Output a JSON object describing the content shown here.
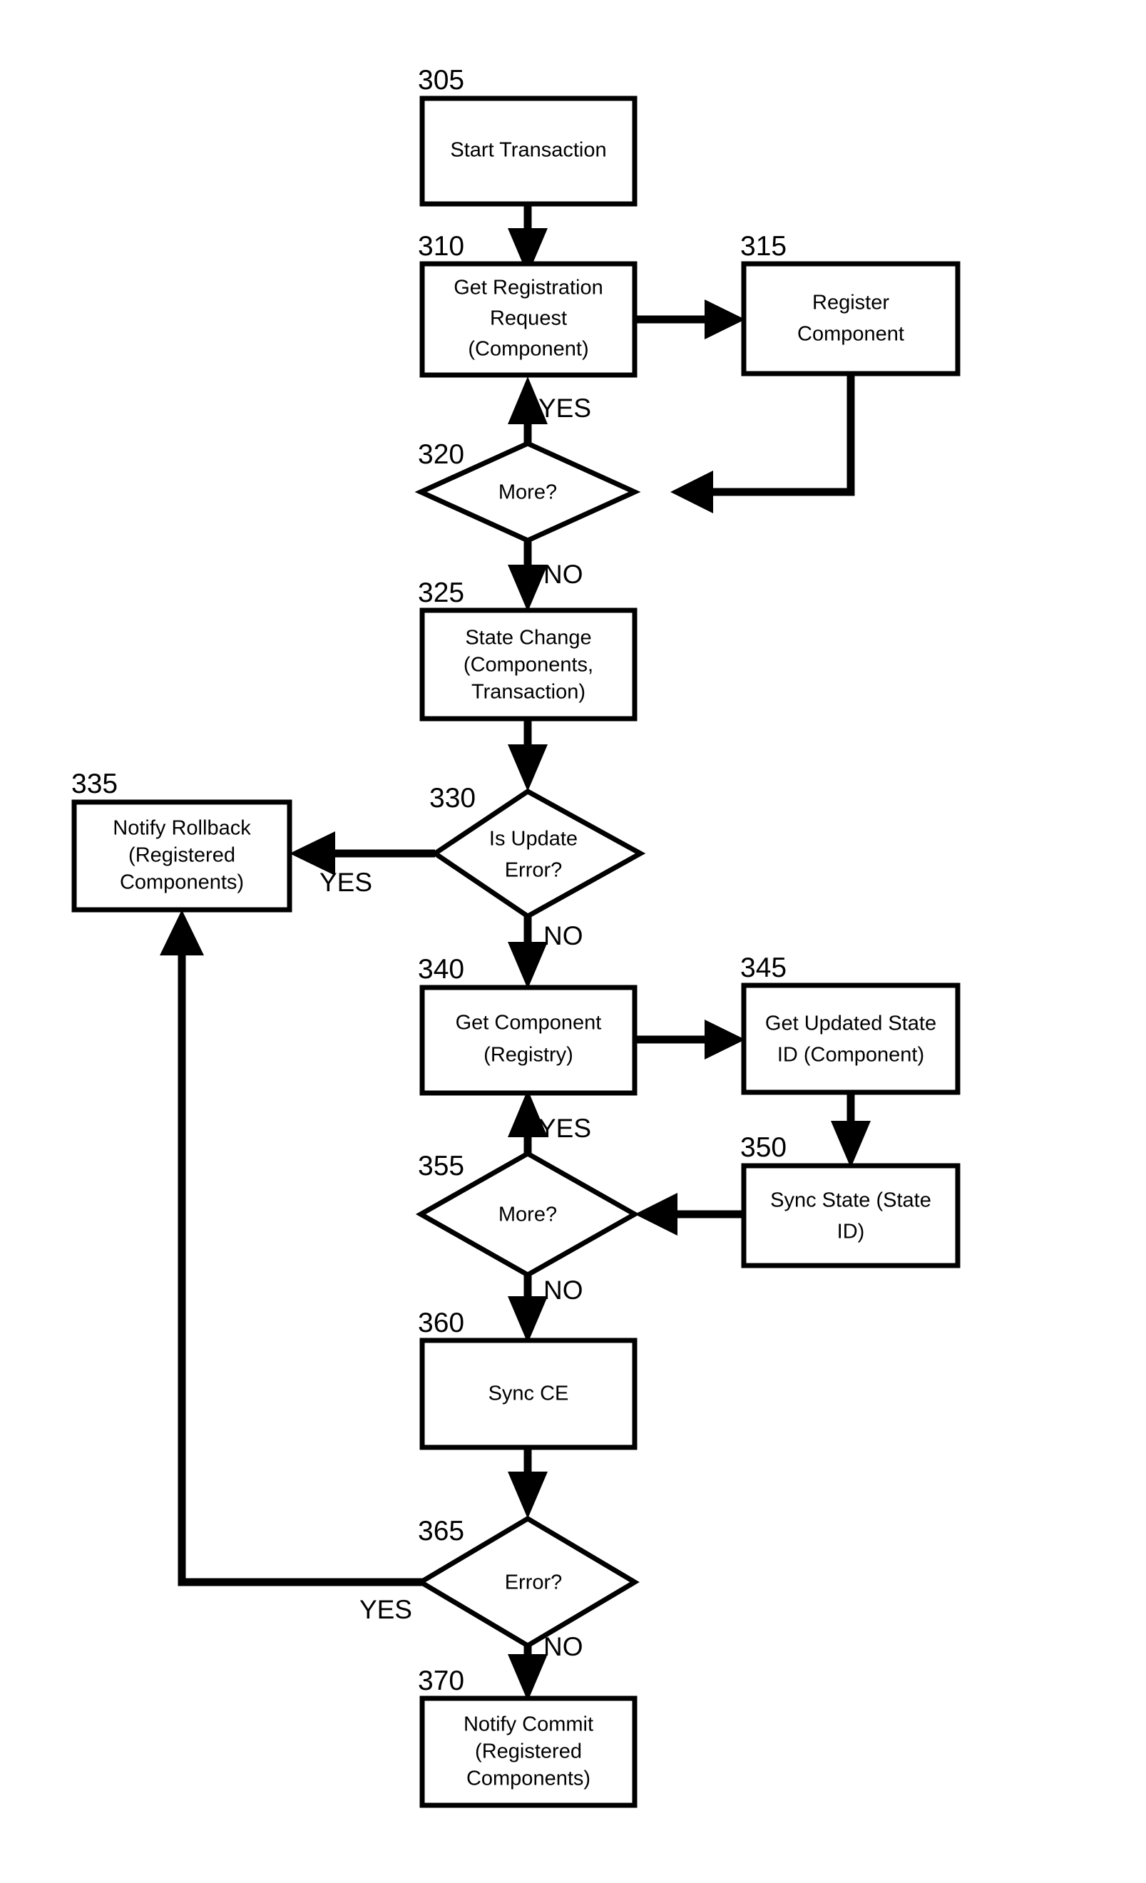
{
  "figure": {
    "type": "flowchart",
    "title": "",
    "background_color": "#ffffff",
    "line_color": "#000000"
  },
  "nodes": [
    {
      "ref": "305",
      "shape": "rect",
      "lines": [
        "Start Transaction"
      ],
      "line1": "Start Transaction",
      "line2": "",
      "line3": ""
    },
    {
      "ref": "310",
      "shape": "rect",
      "lines": [
        "Get Registration",
        "Request",
        "(Component)"
      ],
      "line1": "Get Registration",
      "line2": "Request",
      "line3": "(Component)"
    },
    {
      "ref": "315",
      "shape": "rect",
      "lines": [
        "Register",
        "Component"
      ],
      "line1": "Register",
      "line2": "Component",
      "line3": ""
    },
    {
      "ref": "320",
      "shape": "diamond",
      "lines": [
        "More?"
      ],
      "line1": "More?",
      "line2": "",
      "line3": ""
    },
    {
      "ref": "325",
      "shape": "rect",
      "lines": [
        "State Change",
        "(Components,",
        "Transaction)"
      ],
      "line1": "State Change",
      "line2": "(Components,",
      "line3": "Transaction)"
    },
    {
      "ref": "330",
      "shape": "diamond",
      "lines": [
        "Is Update",
        "Error?"
      ],
      "line1": "Is Update",
      "line2": "Error?",
      "line3": ""
    },
    {
      "ref": "335",
      "shape": "rect",
      "lines": [
        "Notify Rollback",
        "(Registered",
        "Components)"
      ],
      "line1": "Notify Rollback",
      "line2": "(Registered",
      "line3": "Components)"
    },
    {
      "ref": "340",
      "shape": "rect",
      "lines": [
        "Get Component",
        "(Registry)"
      ],
      "line1": "Get Component",
      "line2": "(Registry)",
      "line3": ""
    },
    {
      "ref": "345",
      "shape": "rect",
      "lines": [
        "Get Updated State",
        "ID (Component)"
      ],
      "line1": "Get Updated State",
      "line2": "ID (Component)",
      "line3": ""
    },
    {
      "ref": "350",
      "shape": "rect",
      "lines": [
        "Sync State (State",
        "ID)"
      ],
      "line1": "Sync State (State",
      "line2": "ID)",
      "line3": ""
    },
    {
      "ref": "355",
      "shape": "diamond",
      "lines": [
        "More?"
      ],
      "line1": "More?",
      "line2": "",
      "line3": ""
    },
    {
      "ref": "360",
      "shape": "rect",
      "lines": [
        "Sync CE"
      ],
      "line1": "Sync CE",
      "line2": "",
      "line3": ""
    },
    {
      "ref": "365",
      "shape": "diamond",
      "lines": [
        "Error?"
      ],
      "line1": "Error?",
      "line2": "",
      "line3": ""
    },
    {
      "ref": "370",
      "shape": "rect",
      "lines": [
        "Notify Commit",
        "(Registered",
        "Components)"
      ],
      "line1": "Notify Commit",
      "line2": "(Registered",
      "line3": "Components)"
    }
  ],
  "edge_labels": {
    "yes_320": "YES",
    "no_320": "NO",
    "yes_330": "YES",
    "no_330": "NO",
    "yes_355": "YES",
    "no_355": "NO",
    "yes_365": "YES",
    "no_365": "NO"
  },
  "ref_labels": {
    "n305": "305",
    "n310": "310",
    "n315": "315",
    "n320": "320",
    "n325": "325",
    "n330": "330",
    "n335": "335",
    "n340": "340",
    "n345": "345",
    "n350": "350",
    "n355": "355",
    "n360": "360",
    "n365": "365",
    "n370": "370"
  }
}
